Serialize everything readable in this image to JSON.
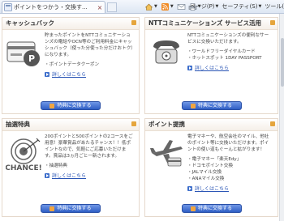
{
  "browser": {
    "tab_title": "ポイントをつかう・交換す...",
    "close_glyph": "×",
    "menus": {
      "page": "ページ(P)",
      "safety": "セーフティ(S)",
      "tools": "ツール(O)"
    },
    "caret": "▼"
  },
  "cards": [
    {
      "title": "キャッシュバック",
      "description": "貯まったポイントをNTTコミュニケーションズの電話やOCN等のご利用料金にキャッシュバック（使った分使った分だけおトク）になります。",
      "items": [
        "・ポイントデータクーポン"
      ],
      "detail_link": "詳しくはこちら",
      "button": "特典に交換する"
    },
    {
      "title": "NTTコミュニケーションズ サービス活用",
      "description": "NTTコミュニケーションズの便利なサービスに交換いただけます。",
      "items": [
        "・ワールドフリーダイヤルカード",
        "・ホットスポット 1DAY PASSPORT"
      ],
      "detail_link": "詳しくはこちら",
      "button": "特典に交換する"
    },
    {
      "title": "抽選特典",
      "description": "200ポイントと500ポイントの2コースをご用意！豪華賞品があたるチャンス！！低ポイントなので、気軽にご応募いただけます。賞品は3ヵ月ごと一新されます。",
      "items": [
        "・抽選特典"
      ],
      "detail_link": "詳しくはこちら",
      "button": "特典に交換する",
      "illustration_text": "CHANCE!"
    },
    {
      "title": "ポイント提携",
      "description": "電子マネーや、航空会社のマイル、他社のポイント等に交換いただけます。ポイントの使い道もぐーんと拡がります！",
      "items": [
        "・電子マネー「楽天Edy」",
        "・ドコモポイント交換",
        "・JALマイル交換",
        "・ANAマイル交換"
      ],
      "detail_link": "詳しくはこちら",
      "button": "特典に交換する"
    }
  ],
  "colors": {
    "accent_orange": "#e5a53c",
    "button_blue": "#2f5fc4",
    "link_blue": "#2a55b5"
  }
}
